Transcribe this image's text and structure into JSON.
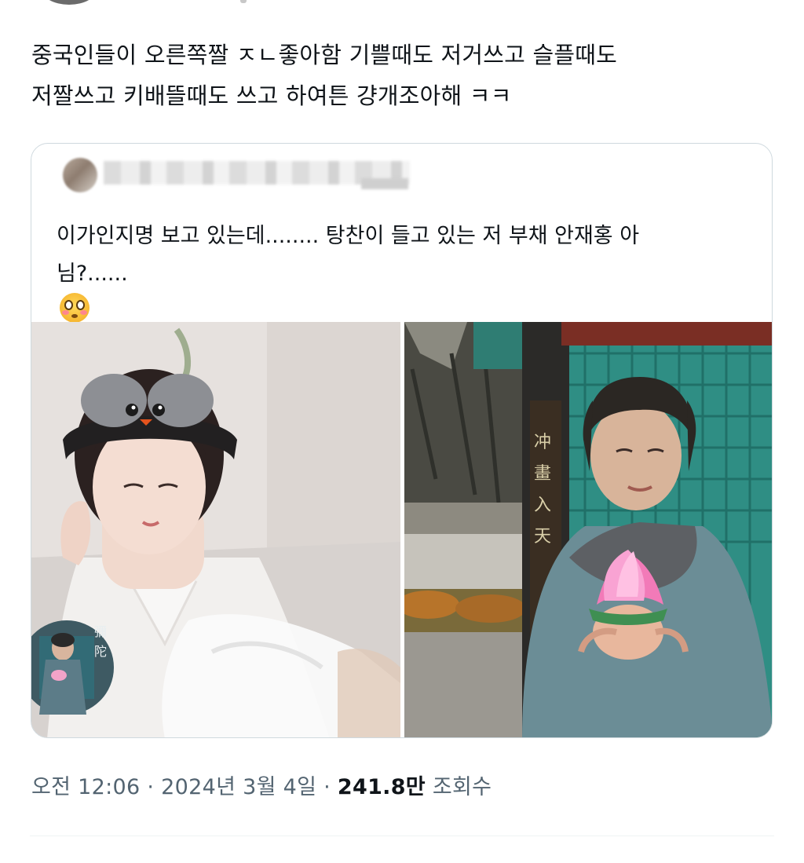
{
  "tweet": {
    "text_lines": [
      "중국인들이 오른쪽짤 ㅈㄴ좋아함 기쁠때도 저거쓰고 슬플때도",
      "저짤쓰고 키배뜰때도 쓰고 하여튼 걍개조아해 ㅋㅋ"
    ]
  },
  "quote": {
    "text_lines": [
      "이가인지명 보고 있는데........ 탕찬이 들고 있는 저 부채 안재홍 아",
      "님?......"
    ],
    "emoji_icons": [
      "flushed-face-icon",
      "flushed-face-icon"
    ],
    "images": [
      {
        "name": "drama-still-photo"
      },
      {
        "name": "lotus-monk-photo"
      }
    ]
  },
  "meta": {
    "time": "오전 12:06",
    "separator": "·",
    "date": "2024년 3월 4일",
    "views_count": "241.8만",
    "views_label": "조회수"
  },
  "colors": {
    "text": "#0f1419",
    "muted": "#536471",
    "border": "#cfd9de"
  }
}
